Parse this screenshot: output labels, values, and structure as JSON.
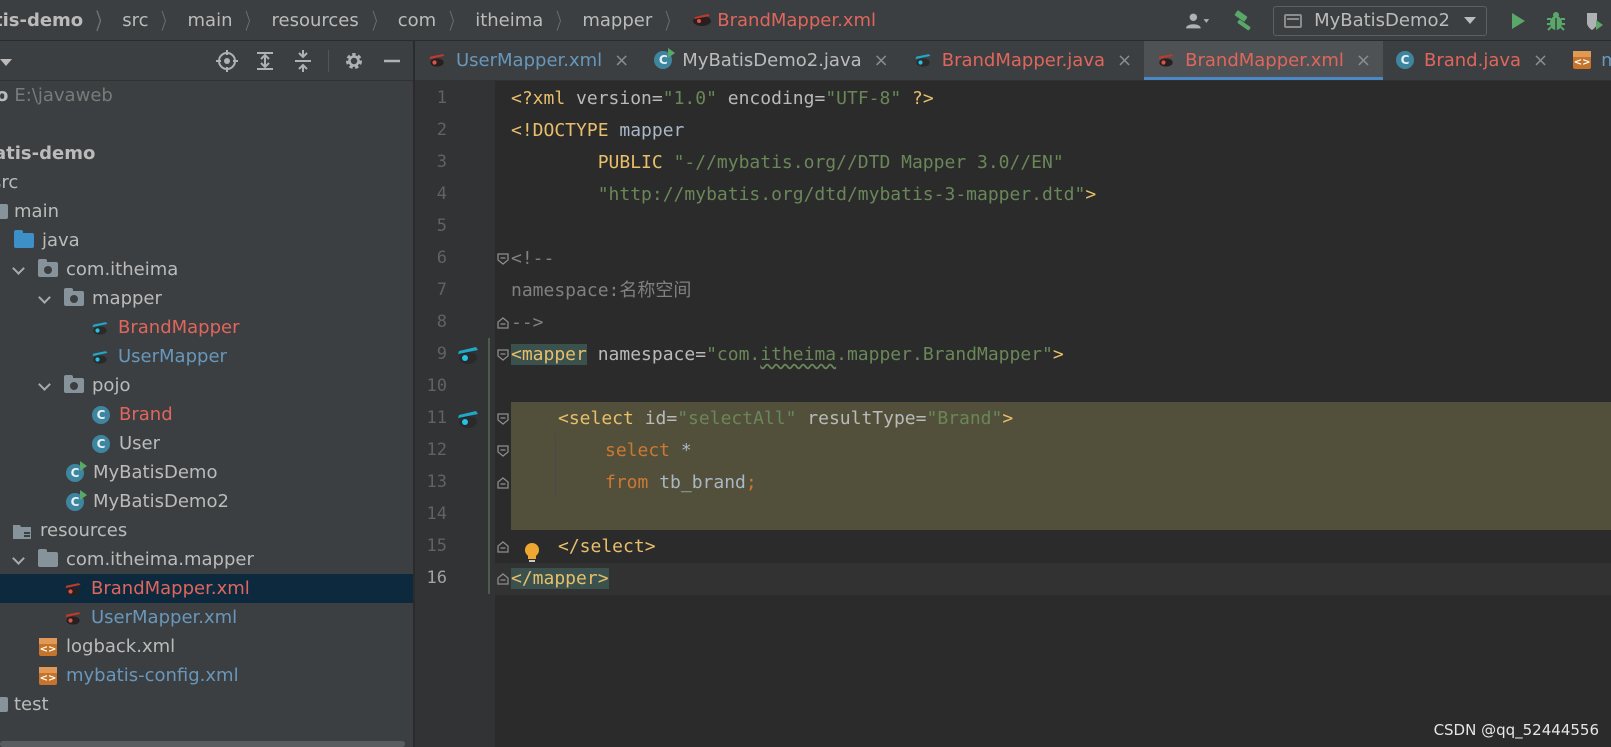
{
  "breadcrumb": {
    "items": [
      "tis-demo",
      "src",
      "main",
      "resources",
      "com",
      "itheima",
      "mapper",
      "BrandMapper.xml"
    ]
  },
  "toolbar": {
    "run_config": "MyBatisDemo2"
  },
  "project": {
    "root_path": "E:\\javaweb",
    "tree": [
      {
        "label": "atis-demo"
      },
      {
        "label": "src"
      },
      {
        "label": "main"
      },
      {
        "label": "java"
      },
      {
        "label": "com.itheima"
      },
      {
        "label": "mapper"
      },
      {
        "label": "BrandMapper"
      },
      {
        "label": "UserMapper"
      },
      {
        "label": "pojo"
      },
      {
        "label": "Brand"
      },
      {
        "label": "User"
      },
      {
        "label": "MyBatisDemo"
      },
      {
        "label": "MyBatisDemo2"
      },
      {
        "label": "resources"
      },
      {
        "label": "com.itheima.mapper"
      },
      {
        "label": "BrandMapper.xml"
      },
      {
        "label": "UserMapper.xml"
      },
      {
        "label": "logback.xml"
      },
      {
        "label": "mybatis-config.xml"
      },
      {
        "label": "test"
      }
    ]
  },
  "tabs": [
    {
      "label": "UserMapper.xml"
    },
    {
      "label": "MyBatisDemo2.java"
    },
    {
      "label": "BrandMapper.java"
    },
    {
      "label": "BrandMapper.xml"
    },
    {
      "label": "Brand.java"
    },
    {
      "label": "myba"
    }
  ],
  "tab_close": "×",
  "editor": {
    "line_numbers": [
      "1",
      "2",
      "3",
      "4",
      "5",
      "6",
      "7",
      "8",
      "9",
      "10",
      "11",
      "12",
      "13",
      "14",
      "15",
      "16"
    ],
    "code": {
      "l1_a": "<?xml ",
      "l1_b": "version",
      "l1_c": "=",
      "l1_d": "\"1.0\"",
      "l1_e": " encoding",
      "l1_f": "=",
      "l1_g": "\"UTF-8\"",
      "l1_h": " ?>",
      "l2_a": "<!DOCTYPE ",
      "l2_b": "mapper",
      "l3_a": "        PUBLIC ",
      "l3_b": "\"-//mybatis.org//DTD Mapper 3.0//EN\"",
      "l4_a": "        \"http://mybatis.org/dtd/mybatis-3-mapper.dtd\"",
      "l4_b": ">",
      "l6": "<!--",
      "l7": "namespace:名称空间",
      "l8": "-->",
      "l9_a": "<mapper",
      "l9_b": " namespace",
      "l9_c": "=",
      "l9_d": "\"com.",
      "l9_e": "itheima",
      "l9_f": ".mapper.BrandMapper\"",
      "l9_g": ">",
      "l11_a": "<select",
      "l11_b": " id",
      "l11_c": "=",
      "l11_d": "\"selectAll\"",
      "l11_e": " resultType",
      "l11_f": "=",
      "l11_g": "\"Brand\"",
      "l11_h": ">",
      "l12_a": "select",
      "l12_b": " *",
      "l13_a": "from",
      "l13_b": " tb_brand",
      "l13_c": ";",
      "l15": "</select>",
      "l16": "</mapper>"
    }
  },
  "watermark": "CSDN @qq_52444556",
  "colors": {
    "accent": "#4a88c7",
    "modified_file": "#e0665c",
    "vcs_added": "#6897bb",
    "selection": "#0d293e"
  }
}
